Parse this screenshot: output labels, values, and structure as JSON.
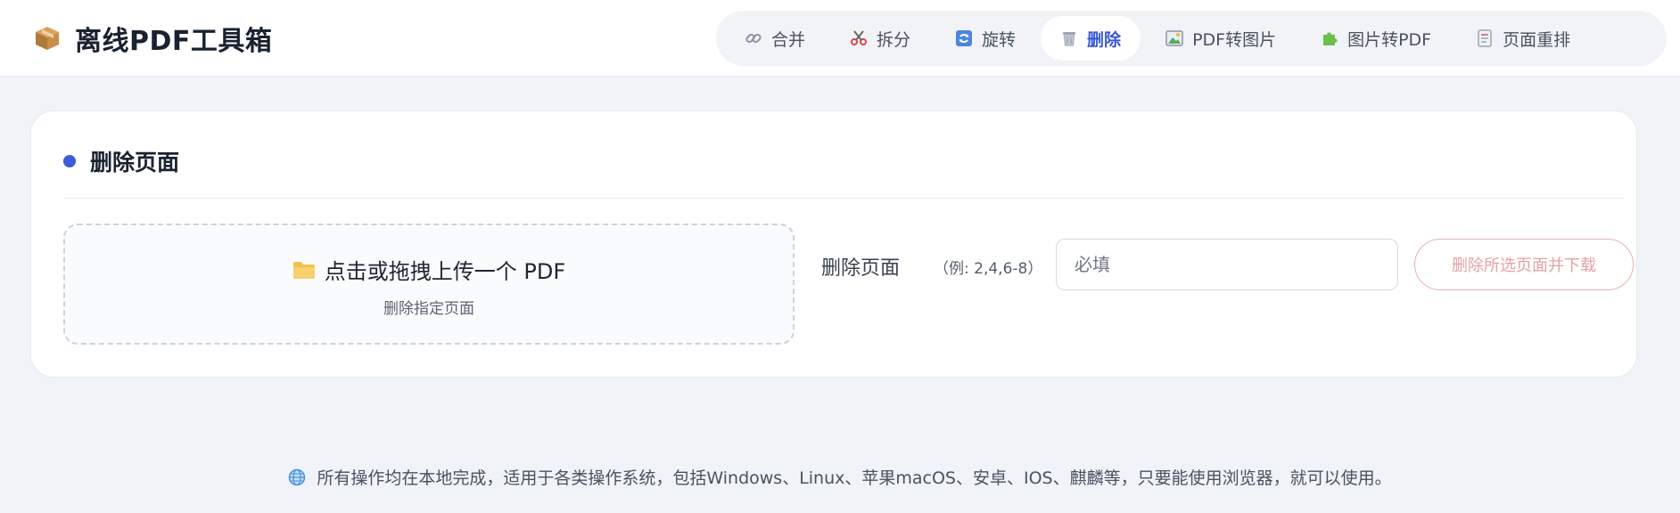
{
  "app": {
    "title": "离线PDF工具箱",
    "brand_icon": "package-box-icon"
  },
  "nav": {
    "items": [
      {
        "label": "合并",
        "icon": "link-icon"
      },
      {
        "label": "拆分",
        "icon": "scissors-icon"
      },
      {
        "label": "旋转",
        "icon": "rotate-icon"
      },
      {
        "label": "删除",
        "icon": "trash-icon",
        "active": true
      },
      {
        "label": "PDF转图片",
        "icon": "picture-icon"
      },
      {
        "label": "图片转PDF",
        "icon": "puzzle-icon"
      },
      {
        "label": "页面重排",
        "icon": "page-icon"
      }
    ]
  },
  "card": {
    "title": "删除页面",
    "dropzone": {
      "main_text": "点击或拖拽上传一个 PDF",
      "sub_text": "删除指定页面"
    },
    "field_label": "删除页面",
    "field_hint": "（例: 2,4,6-8）",
    "input_value": "",
    "input_placeholder": "必填",
    "action_label": "删除所选页面并下载"
  },
  "footer": {
    "text": "所有操作均在本地完成，适用于各类操作系统，包括Windows、Linux、苹果macOS、安卓、IOS、麒麟等，只要能使用浏览器，就可以使用。"
  },
  "colors": {
    "accent": "#3d5bd9",
    "page_bg": "#f0f3f7",
    "action_border": "#e8b2b2",
    "action_text": "#e3a3a3"
  }
}
